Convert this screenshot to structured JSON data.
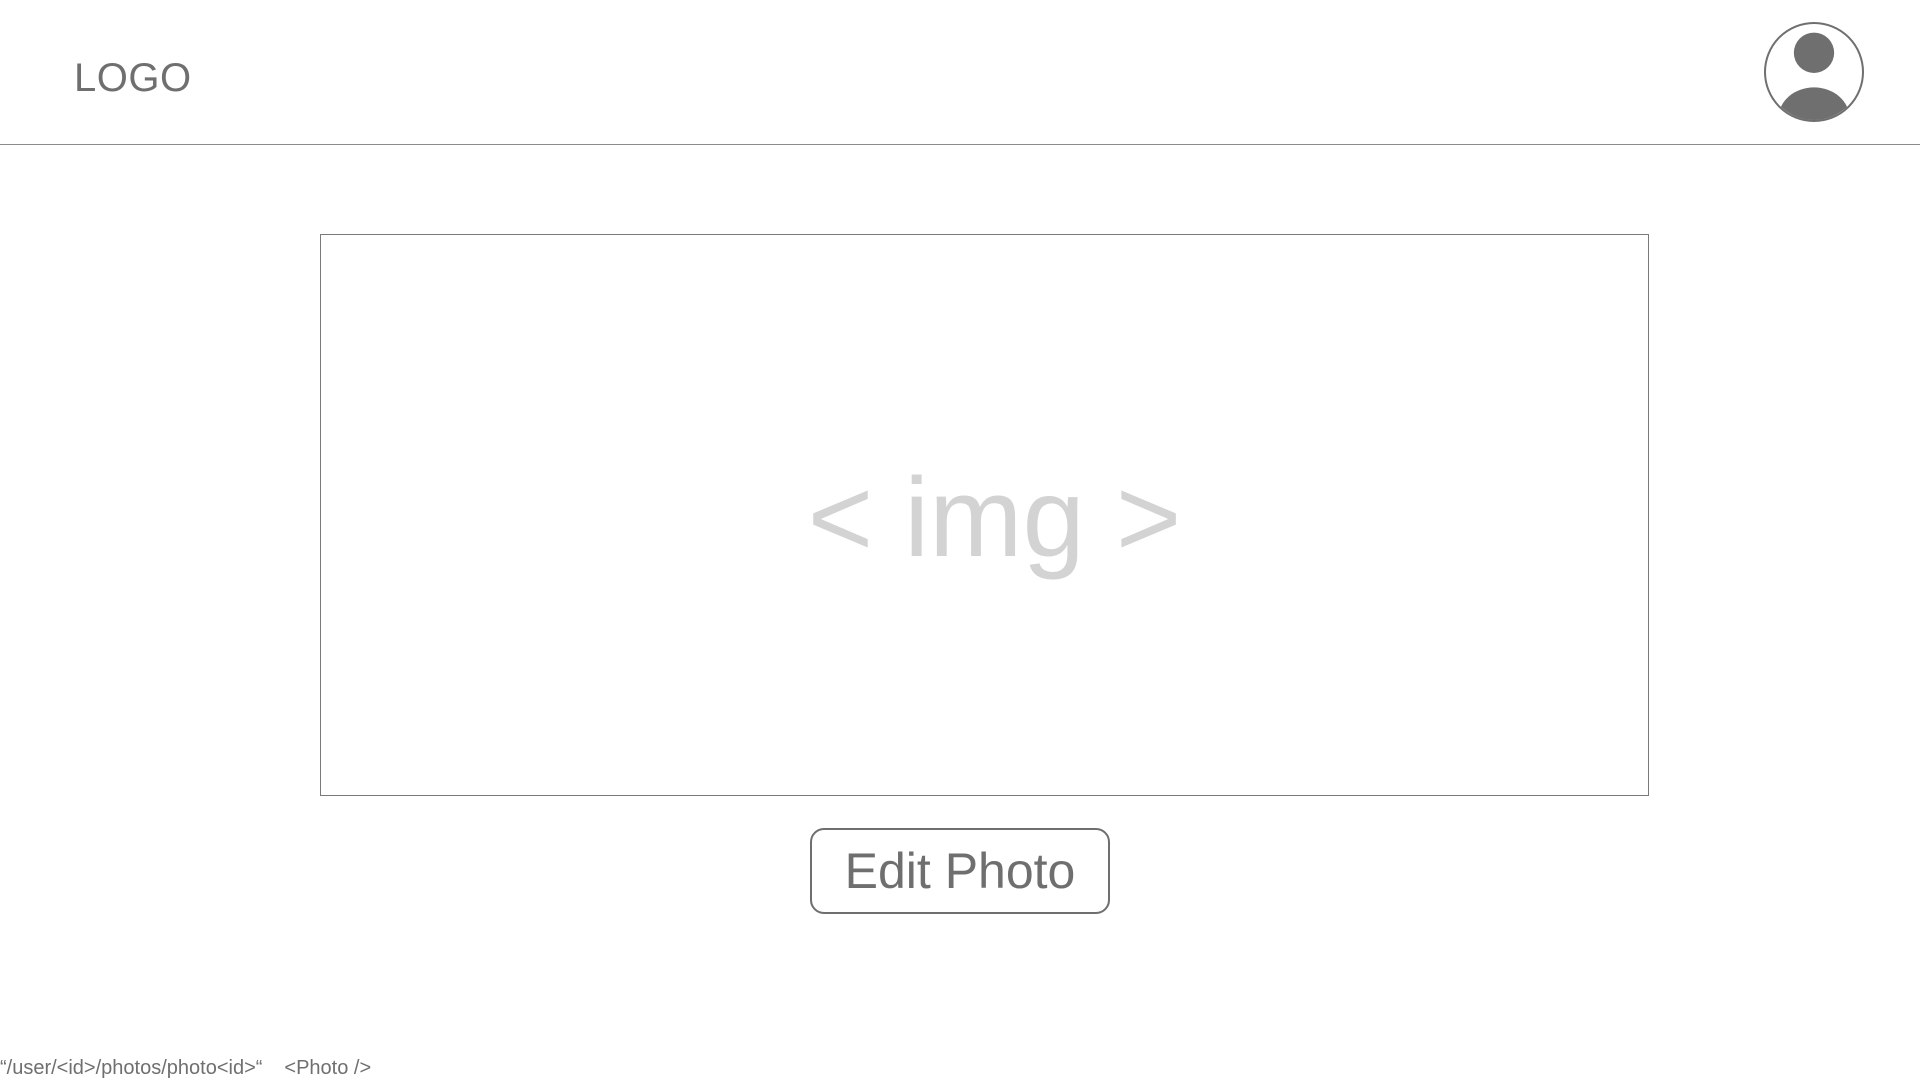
{
  "header": {
    "logo_text": "LOGO",
    "avatar_icon": "user-avatar-icon"
  },
  "main": {
    "image_placeholder": "< img >",
    "edit_button_label": "Edit Photo"
  },
  "footer": {
    "route": "“/user/<id>/photos/photo<id>“",
    "component": "<Photo />"
  },
  "colors": {
    "text": "#6f6f6f",
    "placeholder": "#d3d3d3",
    "border": "#7a7a7a",
    "background": "#ffffff"
  }
}
